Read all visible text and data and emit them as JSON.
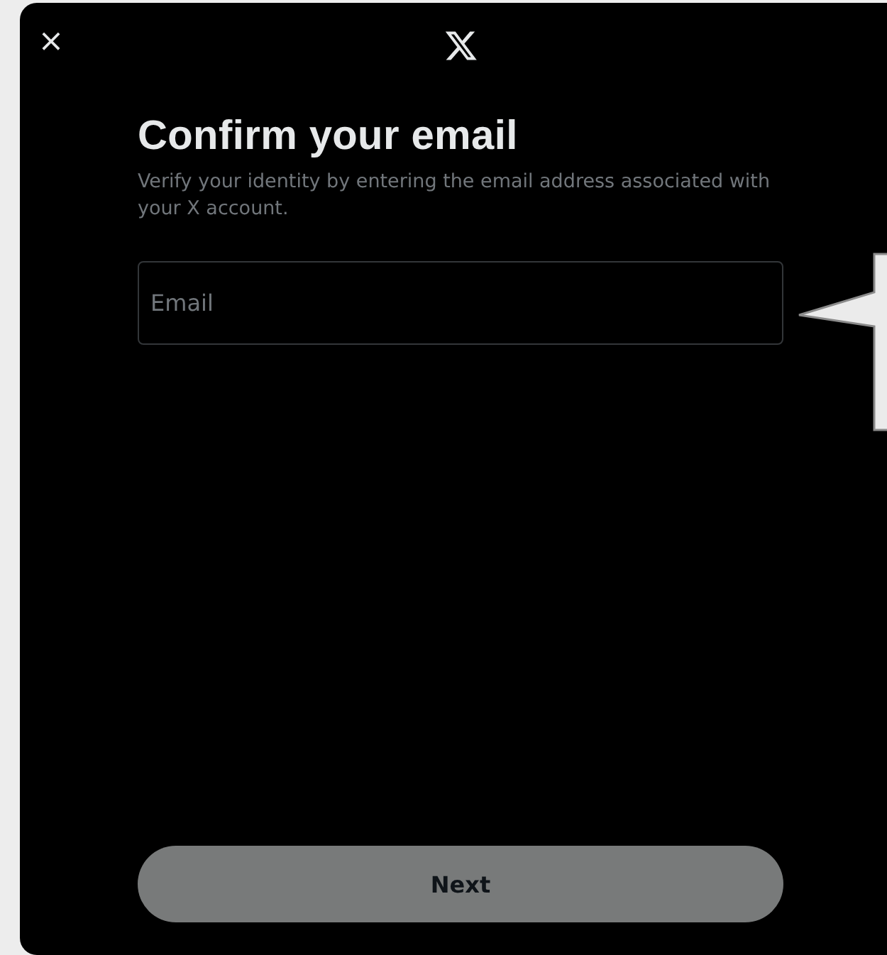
{
  "dialog": {
    "close": "×",
    "title": "Confirm your email",
    "subtitle": "Verify your identity by entering the email address associated with your X account.",
    "email_field": {
      "placeholder": "Email"
    },
    "next_button": {
      "label": "Next",
      "disabled": true
    }
  }
}
